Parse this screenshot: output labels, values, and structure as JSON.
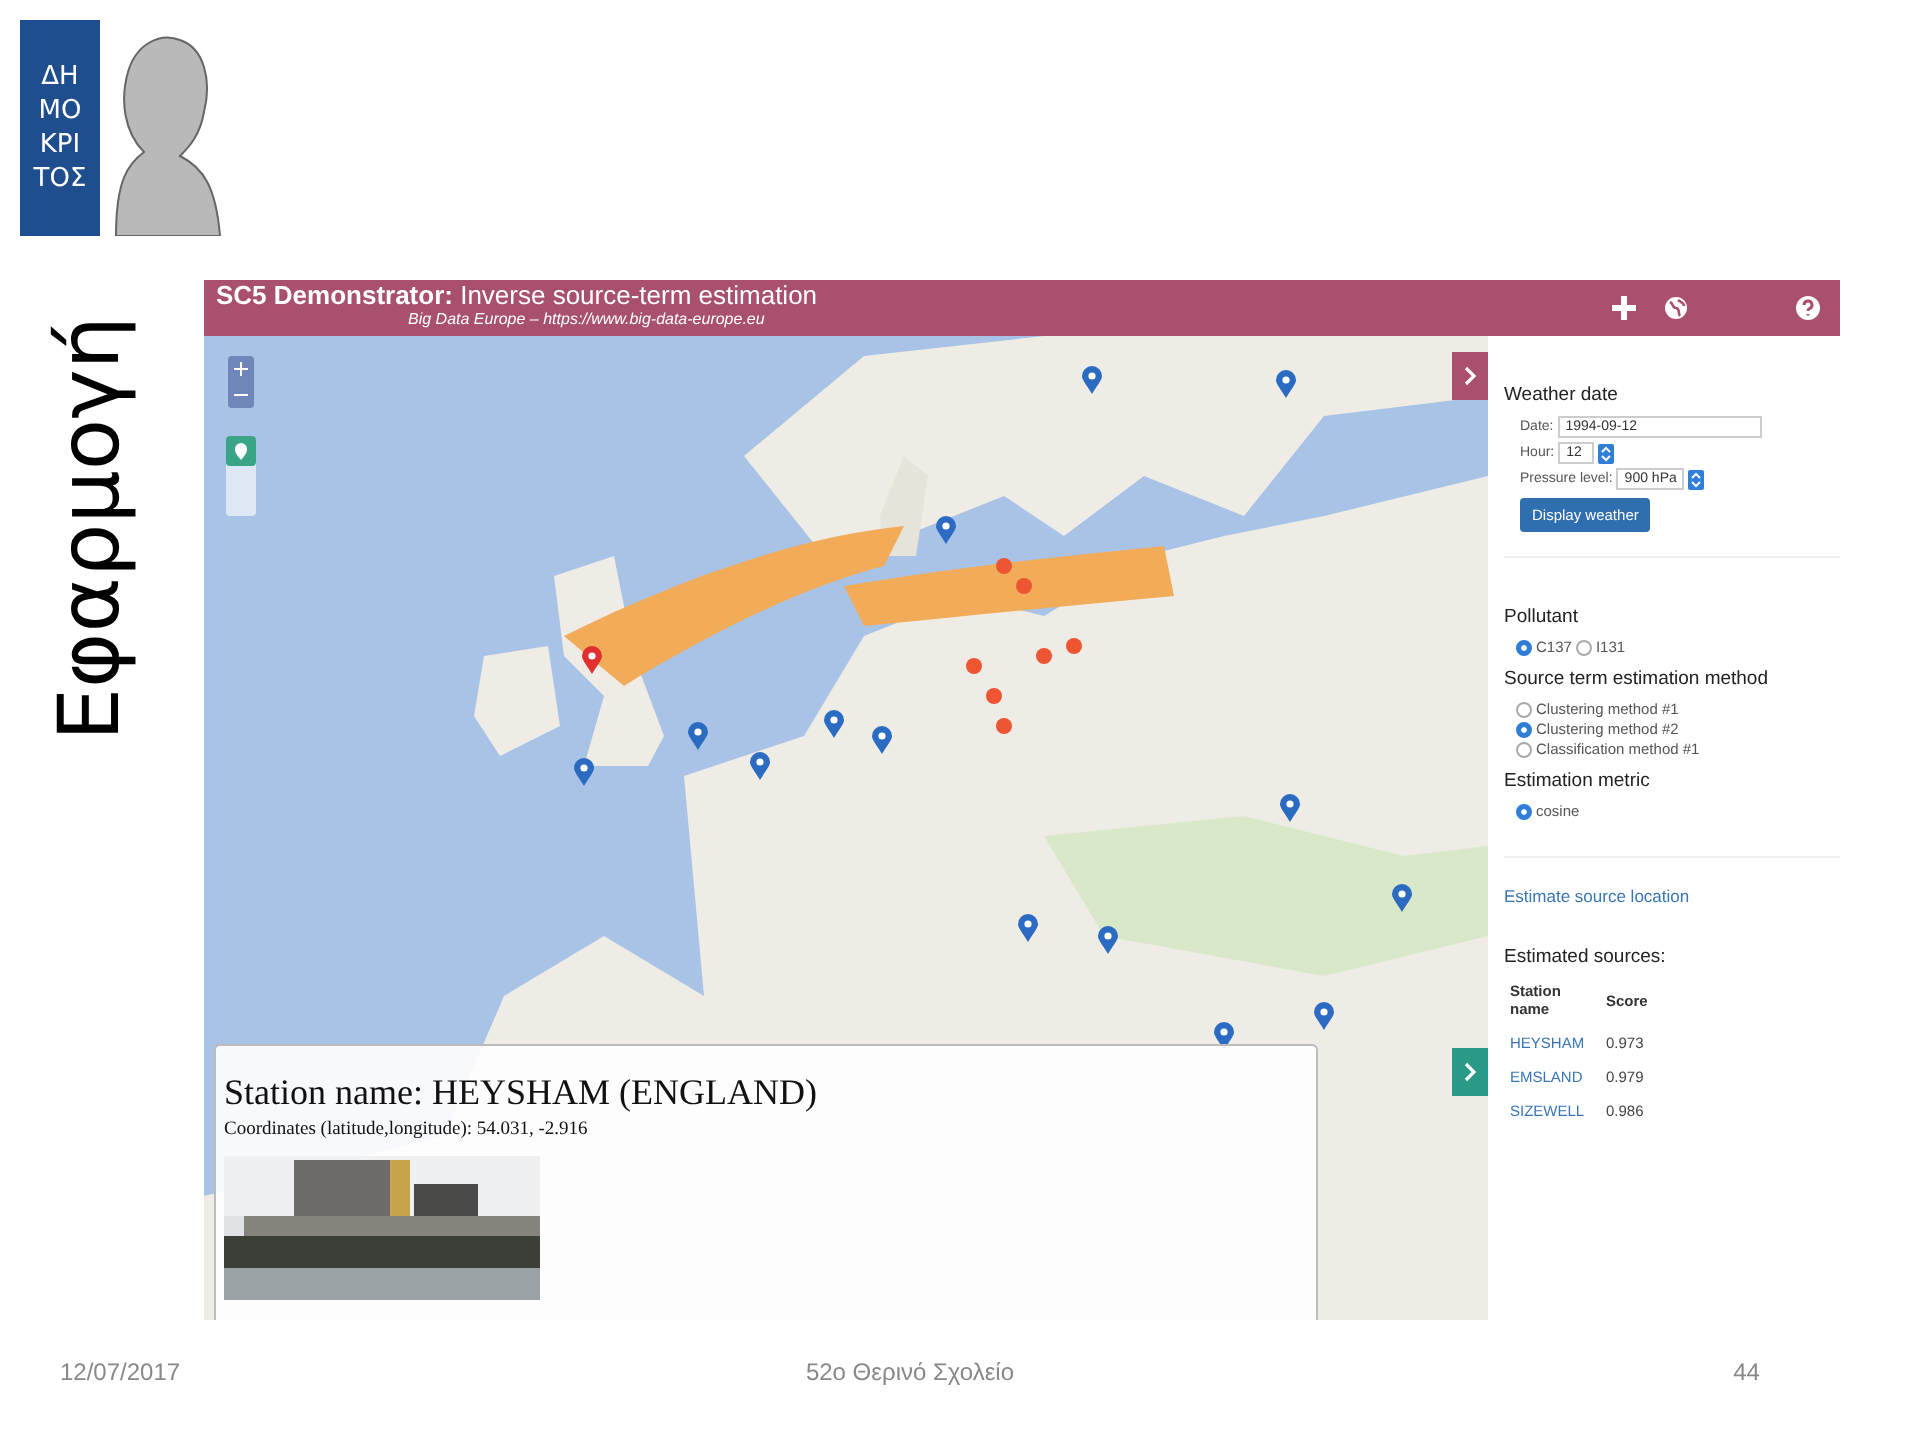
{
  "logo": {
    "letters": [
      "ΔΗ",
      "ΜΟ",
      "ΚΡΙ",
      "ΤΟΣ"
    ]
  },
  "slide_title": "Εφαρμογή",
  "app": {
    "header": {
      "title": "**SC5 Demonstrator:** Inverse source-term estimation",
      "subtitle": "Big Data Europe – https://www.big-data-europe.eu"
    },
    "popup": {
      "station": "Station name: HEYSHAM (ENGLAND)",
      "coordinates": "Coordinates (latitude,longitude): 54.031, -2.916"
    },
    "sidebar": {
      "weather": {
        "heading": "Weather date",
        "date_label": "Date:",
        "date": "1994-09-12",
        "hour_label": "Hour:",
        "hour": "12",
        "pressure_label": "Pressure level:",
        "pressure": "900 hPa",
        "button": "Display weather"
      },
      "pollutant": {
        "heading": "Pollutant",
        "options": [
          {
            "label": "C137",
            "selected": true
          },
          {
            "label": "I131",
            "selected": false
          }
        ]
      },
      "method": {
        "heading": "Source term estimation method",
        "options": [
          {
            "label": "Clustering method #1",
            "selected": false
          },
          {
            "label": "Clustering method #2",
            "selected": true
          },
          {
            "label": "Classification method #1",
            "selected": false
          }
        ]
      },
      "metric": {
        "heading": "Estimation metric",
        "options": [
          {
            "label": "cosine",
            "selected": true
          }
        ]
      },
      "estimate_link": "Estimate source location",
      "results": {
        "heading": "Estimated sources:",
        "columns": [
          "Station name",
          "Score"
        ],
        "rows": [
          {
            "station": "HEYSHAM",
            "score": "0.973"
          },
          {
            "station": "EMSLAND",
            "score": "0.979"
          },
          {
            "station": "SIZEWELL",
            "score": "0.986"
          }
        ]
      }
    }
  },
  "footer": {
    "date": "12/07/2017",
    "center": "52ο Θερινό Σχολείο",
    "page": "44"
  }
}
